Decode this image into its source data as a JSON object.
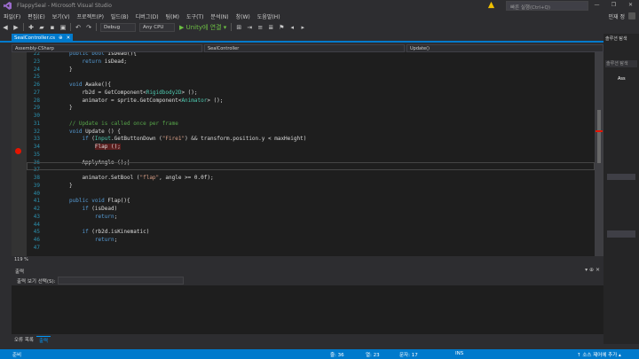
{
  "window": {
    "title": "FlappySeal - Microsoft Visual Studio",
    "minimize": "—",
    "maximize": "❐",
    "close": "✕"
  },
  "quick_launch": {
    "placeholder": "빠른 실행(Ctrl+Q)"
  },
  "menu": {
    "items": [
      "파일(F)",
      "편집(E)",
      "보기(V)",
      "프로젝트(P)",
      "빌드(B)",
      "디버그(D)",
      "팀(M)",
      "도구(T)",
      "분석(N)",
      "창(W)",
      "도움말(H)"
    ],
    "user": "민재 정"
  },
  "toolbar": {
    "config": "Debug",
    "platform": "Any CPU",
    "run_target": "▶ Unity에 연결 ▾"
  },
  "document_tab": {
    "filename": "SealController.cs",
    "pin": "⊕",
    "close": "✕"
  },
  "navbar": {
    "project": "Assembly-CSharp",
    "class": "SealController",
    "member": "Update()"
  },
  "editor": {
    "zoom": "119 %",
    "breakpoint_line": "34",
    "current_line": "36",
    "lines": [
      {
        "n": "22",
        "html": "<span class=\"kw\">public bool</span> IsDead(){"
      },
      {
        "n": "23",
        "html": "    <span class=\"kw\">return</span> isDead;"
      },
      {
        "n": "24",
        "html": "}"
      },
      {
        "n": "25",
        "html": ""
      },
      {
        "n": "26",
        "html": "<span class=\"kw\">void</span> Awake(){"
      },
      {
        "n": "27",
        "html": "    rb2d = GetComponent&lt;<span class=\"ty\">Rigidbody2D</span>&gt; ();"
      },
      {
        "n": "28",
        "html": "    animator = sprite.GetComponent&lt;<span class=\"ty\">Animator</span>&gt; ();"
      },
      {
        "n": "29",
        "html": "}"
      },
      {
        "n": "30",
        "html": ""
      },
      {
        "n": "31",
        "html": "<span class=\"cm\">// Update is called once per frame</span>"
      },
      {
        "n": "32",
        "html": "<span class=\"kw\">void</span> Update () {"
      },
      {
        "n": "33",
        "html": "    <span class=\"kw\">if</span> (<span class=\"ty\">Input</span>.GetButtonDown (<span class=\"st\">\"Fire1\"</span>) &amp;&amp; transform.position.y &lt; maxHeight)"
      },
      {
        "n": "34",
        "html": "        <span class=\"hl\">Flap ();</span>"
      },
      {
        "n": "35",
        "html": ""
      },
      {
        "n": "36",
        "html": "    ApplyAngle ();|"
      },
      {
        "n": "37",
        "html": ""
      },
      {
        "n": "38",
        "html": "    animator.SetBool (<span class=\"st\">\"flap\"</span>, angle &gt;= 0.0f);"
      },
      {
        "n": "39",
        "html": "}"
      },
      {
        "n": "40",
        "html": ""
      },
      {
        "n": "41",
        "html": "<span class=\"kw\">public void</span> Flap(){"
      },
      {
        "n": "42",
        "html": "    <span class=\"kw\">if</span> (isDead)"
      },
      {
        "n": "43",
        "html": "        <span class=\"kw\">return</span>;"
      },
      {
        "n": "44",
        "html": ""
      },
      {
        "n": "45",
        "html": "    <span class=\"kw\">if</span> (rb2d.isKinematic)"
      },
      {
        "n": "46",
        "html": "        <span class=\"kw\">return</span>;"
      },
      {
        "n": "47",
        "html": ""
      }
    ]
  },
  "right_panel": {
    "title": "솔루션 탐색",
    "search": "솔루션 탐색",
    "item": "Ass"
  },
  "output": {
    "title": "출력",
    "source_label": "출력 보기 선택(S):",
    "tabs": [
      "오류 목록",
      "출력"
    ]
  },
  "statusbar": {
    "ready": "준비",
    "line": "줄: 36",
    "col": "열: 23",
    "char": "문자: 17",
    "ins": "INS",
    "source_control": "↑ 소스 제어에 추가 ▴"
  },
  "colors": {
    "accent": "#007acc",
    "breakpoint": "#e51400",
    "editor_bg": "#1e1e1e"
  }
}
